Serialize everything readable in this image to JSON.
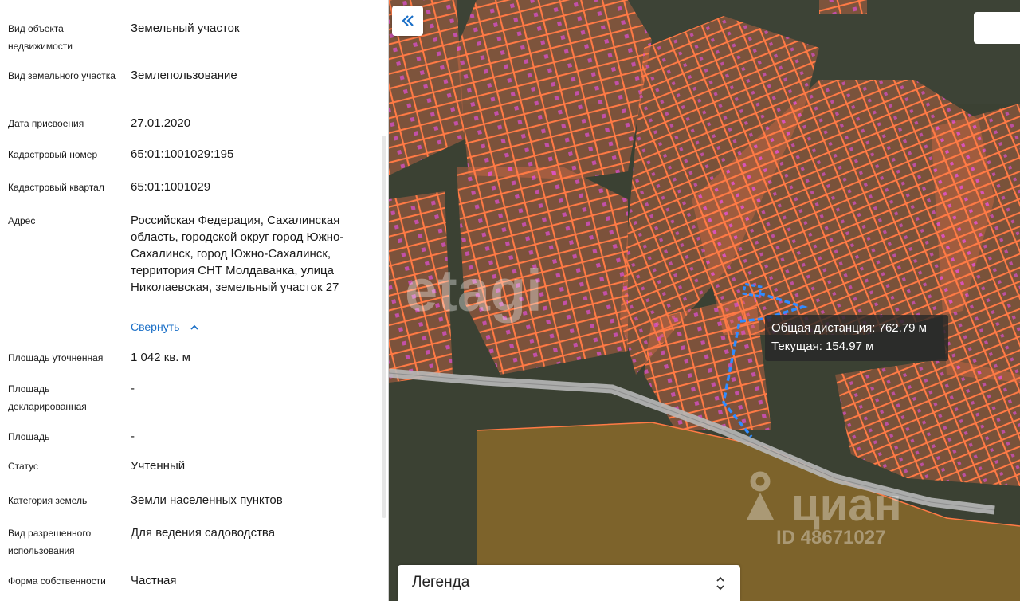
{
  "details": [
    {
      "label": "Вид объекта недвижимости",
      "value": "Земельный участок"
    },
    {
      "label": "Вид земельного участка",
      "value": "Землепользование"
    },
    {
      "label": "Дата присвоения",
      "value": "27.01.2020"
    },
    {
      "label": "Кадастровый номер",
      "value": "65:01:1001029:195"
    },
    {
      "label": "Кадастровый квартал",
      "value": "65:01:1001029"
    },
    {
      "label": "Адрес",
      "value": "Российская Федерация, Сахалинская область, городской округ город Южно-Сахалинск, город Южно-Сахалинск, территория СНТ Молдаванка, улица Николаевская, земельный участок 27"
    },
    {
      "label": "Площадь уточненная",
      "value": "1 042 кв. м"
    },
    {
      "label": "Площадь декларированная",
      "value": "-"
    },
    {
      "label": "Площадь",
      "value": "-"
    },
    {
      "label": "Статус",
      "value": "Учтенный"
    },
    {
      "label": "Категория земель",
      "value": "Земли населенных пунктов"
    },
    {
      "label": "Вид разрешенного использования",
      "value": "Для ведения садоводства"
    },
    {
      "label": "Форма собственности",
      "value": "Частная"
    }
  ],
  "collapse_link": "Свернуть",
  "map": {
    "tooltip_total": "Общая дистанция: 762.79 м",
    "tooltip_current": "Текущая: 154.97 м",
    "legend_label": "Легенда",
    "watermark_left": "etagi",
    "watermark_brand": "циан",
    "watermark_id": "ID 48671027",
    "back_icon": "double-chevron-left-icon",
    "parcel_color": "#ff7a45",
    "measure_color": "#2f8cff"
  }
}
